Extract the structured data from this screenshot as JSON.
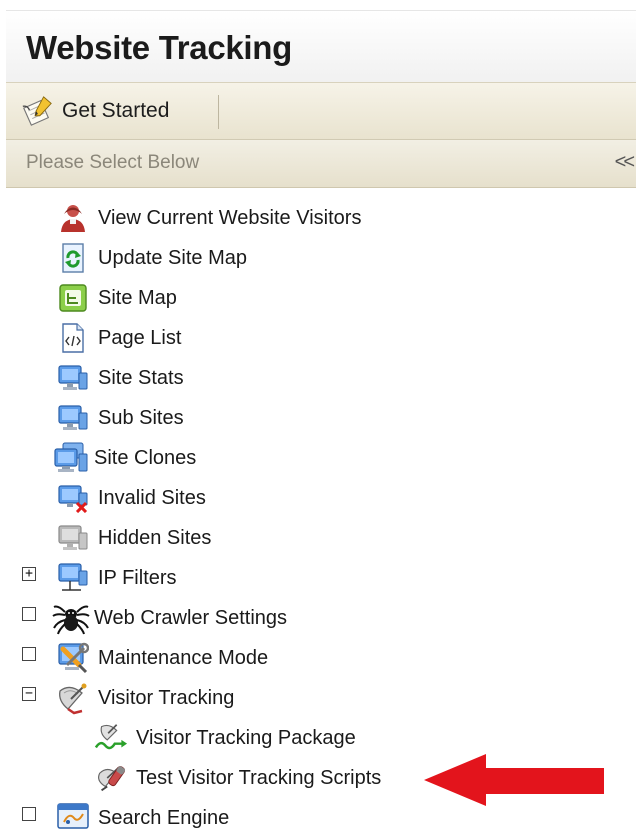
{
  "header": {
    "title": "Website Tracking"
  },
  "toolbar": {
    "get_started_label": "Get Started",
    "get_started_icon": "notepad-pencil-icon"
  },
  "panel": {
    "select_label": "Please Select Below",
    "collapse_symbol": "<<"
  },
  "tree": {
    "items": [
      {
        "label": "View Current Website Visitors",
        "icon": "visitor-person-icon"
      },
      {
        "label": "Update Site Map",
        "icon": "refresh-document-icon"
      },
      {
        "label": "Site Map",
        "icon": "site-map-icon"
      },
      {
        "label": "Page List",
        "icon": "html-page-icon"
      },
      {
        "label": "Site Stats",
        "icon": "monitor-icon"
      },
      {
        "label": "Sub Sites",
        "icon": "monitor-icon"
      },
      {
        "label": "Site Clones",
        "icon": "multi-monitor-icon"
      },
      {
        "label": "Invalid Sites",
        "icon": "monitor-error-icon"
      },
      {
        "label": "Hidden Sites",
        "icon": "monitor-gray-icon"
      },
      {
        "label": "IP Filters",
        "icon": "network-monitor-icon",
        "toggle": "+"
      },
      {
        "label": "Web Crawler Settings",
        "icon": "spider-icon",
        "toggle": ""
      },
      {
        "label": "Maintenance Mode",
        "icon": "wrench-screwdriver-icon",
        "toggle": ""
      },
      {
        "label": "Visitor Tracking",
        "icon": "satellite-dish-icon",
        "toggle": "−"
      },
      {
        "label": "Visitor Tracking Package",
        "icon": "tracking-package-icon"
      },
      {
        "label": "Test Visitor Tracking Scripts",
        "icon": "test-dish-icon"
      },
      {
        "label": "Search Engine",
        "icon": "search-engine-icon",
        "toggle": ""
      }
    ]
  },
  "colors": {
    "title_bg": "#f1f1f1",
    "toolbar_bg": "#ede7d3",
    "select_text": "#8b877a",
    "annotation_arrow": "#e3141c"
  }
}
